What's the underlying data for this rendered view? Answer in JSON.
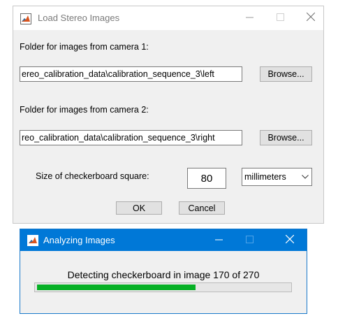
{
  "load_dialog": {
    "title": "Load Stereo Images",
    "camera1_label": "Folder for images from camera 1:",
    "camera1_path": "ereo_calibration_data\\calibration_sequence_3\\left",
    "camera2_label": "Folder for images from camera 2:",
    "camera2_path": "reo_calibration_data\\calibration_sequence_3\\right",
    "browse_label": "Browse...",
    "square_label": "Size of checkerboard square:",
    "square_size": "80",
    "unit_selected": "millimeters",
    "ok_label": "OK",
    "cancel_label": "Cancel"
  },
  "progress_dialog": {
    "title": "Analyzing Images",
    "status": "Detecting checkerboard in image 170 of 270",
    "progress_fraction": 0.6296,
    "progress_color": "#06b025"
  },
  "colors": {
    "active_titlebar": "#0078d7",
    "dialog_background": "#f0f0f0"
  },
  "icons": [
    "matlab-icon",
    "minimize-icon",
    "maximize-icon",
    "close-icon",
    "chevron-down-icon"
  ]
}
